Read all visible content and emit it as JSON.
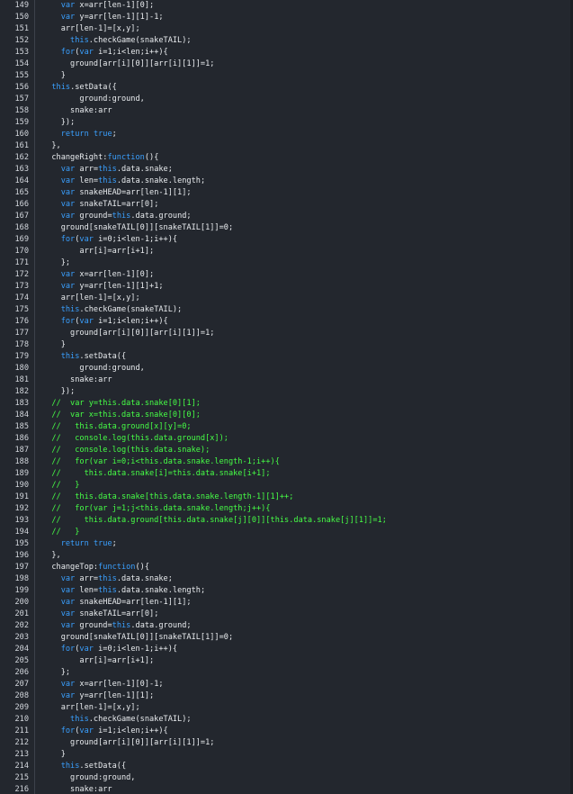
{
  "editor": {
    "lines": [
      {
        "n": "149",
        "text": "    var x=arr[len-1][0];"
      },
      {
        "n": "150",
        "text": "    var y=arr[len-1][1]-1;"
      },
      {
        "n": "151",
        "text": "    arr[len-1]=[x,y];"
      },
      {
        "n": "152",
        "text": "      this.checkGame(snakeTAIL);"
      },
      {
        "n": "153",
        "text": "    for(var i=1;i<len;i++){"
      },
      {
        "n": "154",
        "text": "      ground[arr[i][0]][arr[i][1]]=1;"
      },
      {
        "n": "155",
        "text": "    }"
      },
      {
        "n": "156",
        "text": "  this.setData({"
      },
      {
        "n": "157",
        "text": "        ground:ground,"
      },
      {
        "n": "158",
        "text": "      snake:arr"
      },
      {
        "n": "159",
        "text": "    });"
      },
      {
        "n": "160",
        "text": "    return true;"
      },
      {
        "n": "161",
        "text": "  },"
      },
      {
        "n": "162",
        "text": "  changeRight:function(){"
      },
      {
        "n": "163",
        "text": "    var arr=this.data.snake;"
      },
      {
        "n": "164",
        "text": "    var len=this.data.snake.length;"
      },
      {
        "n": "165",
        "text": "    var snakeHEAD=arr[len-1][1];"
      },
      {
        "n": "166",
        "text": "    var snakeTAIL=arr[0];"
      },
      {
        "n": "167",
        "text": "    var ground=this.data.ground;"
      },
      {
        "n": "168",
        "text": "    ground[snakeTAIL[0]][snakeTAIL[1]]=0;"
      },
      {
        "n": "169",
        "text": "    for(var i=0;i<len-1;i++){"
      },
      {
        "n": "170",
        "text": "        arr[i]=arr[i+1];"
      },
      {
        "n": "171",
        "text": "    };"
      },
      {
        "n": "172",
        "text": "    var x=arr[len-1][0];"
      },
      {
        "n": "173",
        "text": "    var y=arr[len-1][1]+1;"
      },
      {
        "n": "174",
        "text": "    arr[len-1]=[x,y];"
      },
      {
        "n": "175",
        "text": "    this.checkGame(snakeTAIL);"
      },
      {
        "n": "176",
        "text": "    for(var i=1;i<len;i++){"
      },
      {
        "n": "177",
        "text": "      ground[arr[i][0]][arr[i][1]]=1;"
      },
      {
        "n": "178",
        "text": "    }"
      },
      {
        "n": "179",
        "text": "    this.setData({"
      },
      {
        "n": "180",
        "text": "        ground:ground,"
      },
      {
        "n": "181",
        "text": "      snake:arr"
      },
      {
        "n": "182",
        "text": "    });"
      },
      {
        "n": "183",
        "text": "  //  var y=this.data.snake[0][1];"
      },
      {
        "n": "184",
        "text": "  //  var x=this.data.snake[0][0];"
      },
      {
        "n": "185",
        "text": "  //   this.data.ground[x][y]=0;"
      },
      {
        "n": "186",
        "text": "  //   console.log(this.data.ground[x]);"
      },
      {
        "n": "187",
        "text": "  //   console.log(this.data.snake);"
      },
      {
        "n": "188",
        "text": "  //   for(var i=0;i<this.data.snake.length-1;i++){"
      },
      {
        "n": "189",
        "text": "  //     this.data.snake[i]=this.data.snake[i+1];"
      },
      {
        "n": "190",
        "text": "  //   }"
      },
      {
        "n": "191",
        "text": "  //   this.data.snake[this.data.snake.length-1][1]++;"
      },
      {
        "n": "192",
        "text": "  //   for(var j=1;j<this.data.snake.length;j++){"
      },
      {
        "n": "193",
        "text": "  //     this.data.ground[this.data.snake[j][0]][this.data.snake[j][1]]=1;"
      },
      {
        "n": "194",
        "text": "  //   }"
      },
      {
        "n": "195",
        "text": "    return true;"
      },
      {
        "n": "196",
        "text": "  },"
      },
      {
        "n": "197",
        "text": "  changeTop:function(){"
      },
      {
        "n": "198",
        "text": "    var arr=this.data.snake;"
      },
      {
        "n": "199",
        "text": "    var len=this.data.snake.length;"
      },
      {
        "n": "200",
        "text": "    var snakeHEAD=arr[len-1][1];"
      },
      {
        "n": "201",
        "text": "    var snakeTAIL=arr[0];"
      },
      {
        "n": "202",
        "text": "    var ground=this.data.ground;"
      },
      {
        "n": "203",
        "text": "    ground[snakeTAIL[0]][snakeTAIL[1]]=0;"
      },
      {
        "n": "204",
        "text": "    for(var i=0;i<len-1;i++){"
      },
      {
        "n": "205",
        "text": "        arr[i]=arr[i+1];"
      },
      {
        "n": "206",
        "text": "    };"
      },
      {
        "n": "207",
        "text": "    var x=arr[len-1][0]-1;"
      },
      {
        "n": "208",
        "text": "    var y=arr[len-1][1];"
      },
      {
        "n": "209",
        "text": "    arr[len-1]=[x,y];"
      },
      {
        "n": "210",
        "text": "      this.checkGame(snakeTAIL);"
      },
      {
        "n": "211",
        "text": "    for(var i=1;i<len;i++){"
      },
      {
        "n": "212",
        "text": "      ground[arr[i][0]][arr[i][1]]=1;"
      },
      {
        "n": "213",
        "text": "    }"
      },
      {
        "n": "214",
        "text": "    this.setData({"
      },
      {
        "n": "215",
        "text": "      ground:ground,"
      },
      {
        "n": "216",
        "text": "      snake:arr"
      }
    ]
  },
  "colors": {
    "background": "#23272e",
    "line_number": "#d2d6dc",
    "text": "#e9ecef",
    "keyword": "#3aa0ff",
    "comment": "#46ff46"
  }
}
